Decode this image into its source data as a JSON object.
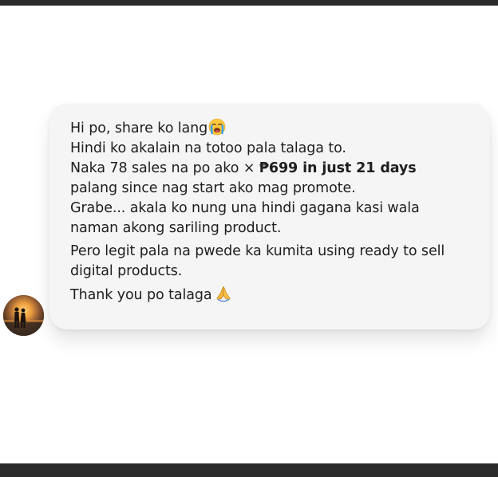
{
  "chat": {
    "message": {
      "line1": "Hi po, share ko lang",
      "line2": "Hindi ko akalain na totoo pala talaga to.",
      "line3_pre": "Naka 78 sales na po ako × ",
      "line3_bold": "₱699 in just 21 days",
      "line4": "palang since nag start ako mag promote.",
      "line5": "Grabe... akala ko nung una hindi gagana kasi wala",
      "line6": "naman akong sariling product.",
      "line7": "Pero legit pala na pwede ka kumita using ready to sell",
      "line8": "digital products.",
      "line9": "Thank you po talaga"
    },
    "icons": {
      "line1_emoji": "crying-face-icon",
      "line9_emoji": "folded-hands-icon",
      "avatar": "sunset-couple-avatar"
    },
    "colors": {
      "bubble": "#f5f5f5",
      "text": "#1e1e1e",
      "frame_bar": "#2b2b2b"
    }
  }
}
